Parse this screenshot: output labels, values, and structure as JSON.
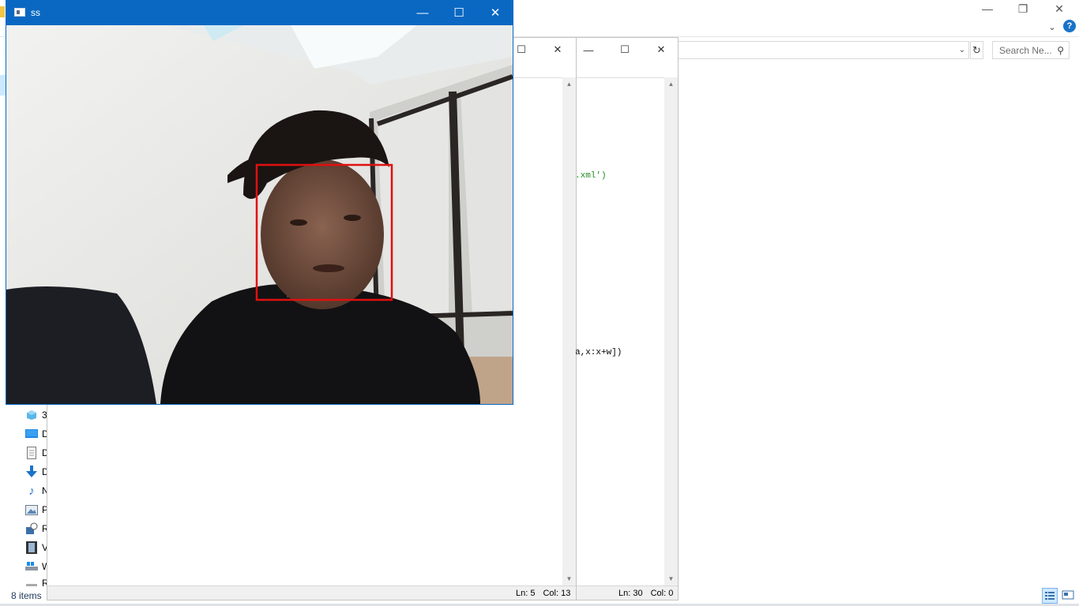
{
  "explorer": {
    "search_placeholder": "Search Ne...",
    "status_count": "8 items",
    "nav_items": [
      {
        "label": "3",
        "icon": "3d-objects-icon"
      },
      {
        "label": "D",
        "icon": "desktop-icon"
      },
      {
        "label": "D",
        "icon": "documents-icon"
      },
      {
        "label": "D",
        "icon": "downloads-icon"
      },
      {
        "label": "N",
        "icon": "music-icon"
      },
      {
        "label": "P",
        "icon": "pictures-icon"
      },
      {
        "label": "R",
        "icon": "recent-icon"
      },
      {
        "label": "V",
        "icon": "videos-icon"
      },
      {
        "label": "W",
        "icon": "local-disk-icon"
      },
      {
        "label": "R",
        "icon": "drive-icon"
      }
    ],
    "help_label": "?"
  },
  "editor1": {
    "code_line_1": ".xml')",
    "code_line_2": "a,x:x+w])",
    "status_ln": "Ln: 5",
    "status_col": "Col: 13"
  },
  "editor2": {
    "status_ln": "Ln: 30",
    "status_col": "Col: 0"
  },
  "webcam": {
    "title": "ss",
    "detection_box_color": "#e01010"
  }
}
